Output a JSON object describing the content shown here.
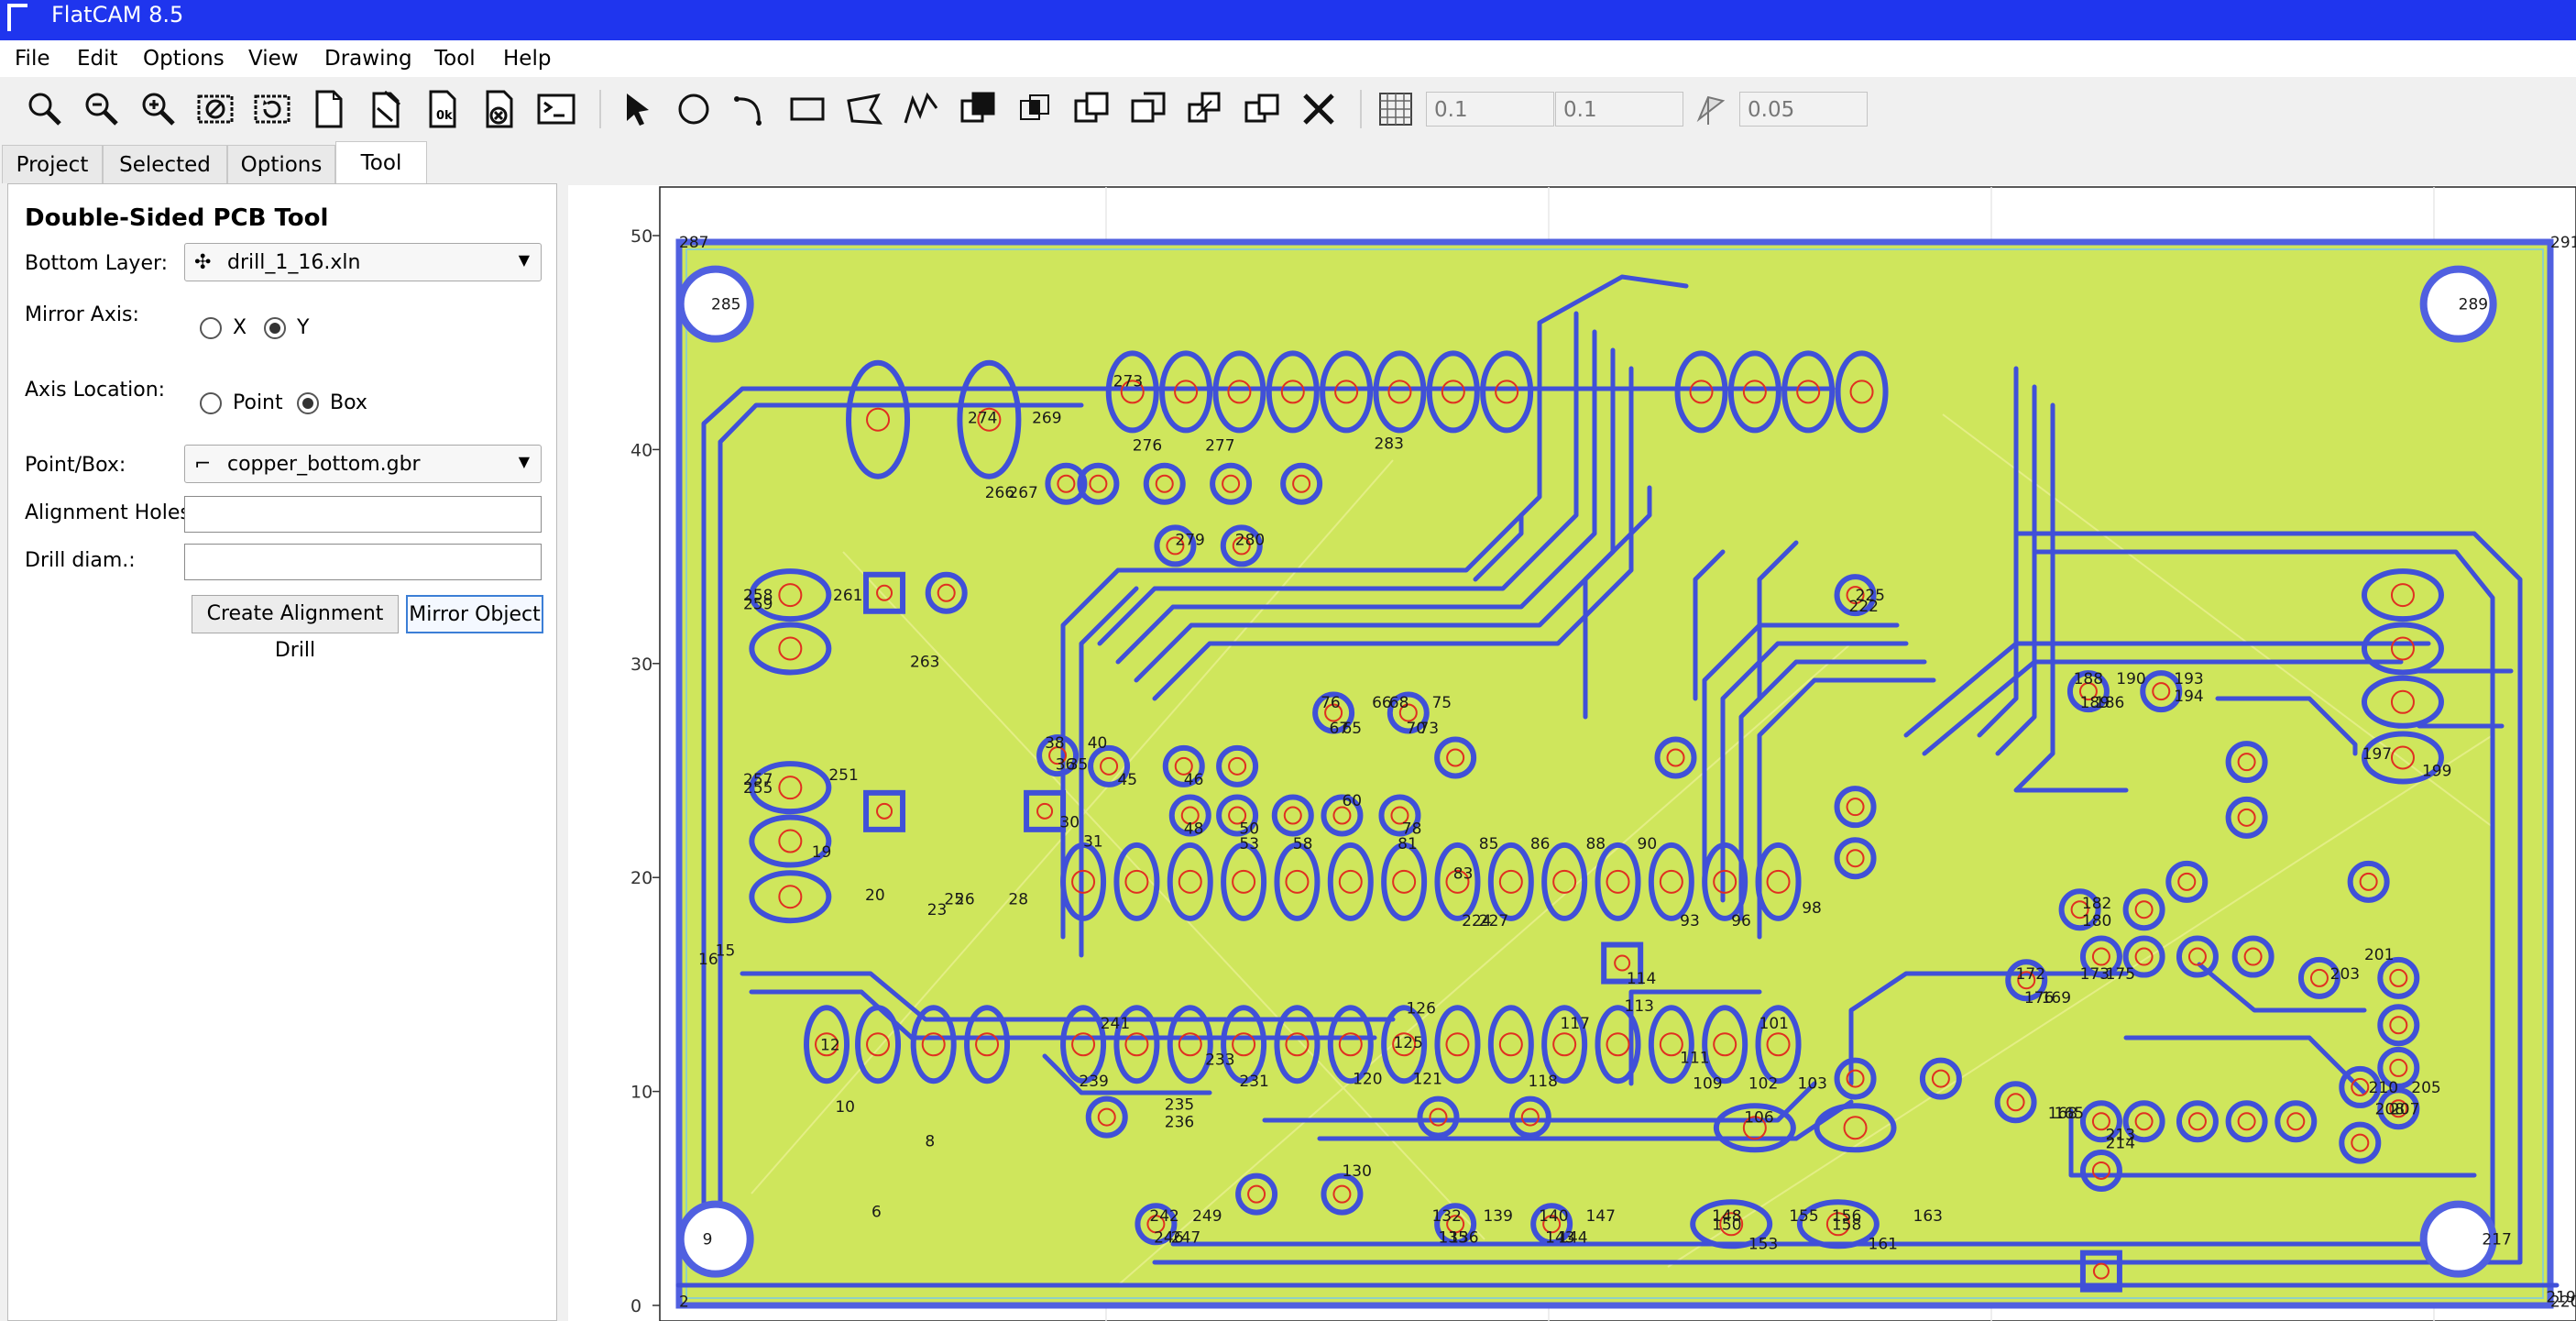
{
  "window": {
    "title": "FlatCAM 8.5"
  },
  "menu": [
    "File",
    "Edit",
    "Options",
    "View",
    "Drawing",
    "Tool",
    "Help"
  ],
  "toolbar": {
    "icons": [
      "zoom-fit-icon",
      "zoom-out-icon",
      "zoom-in-icon",
      "clear-plot-icon",
      "replot-icon",
      "new-project-icon",
      "new-geometry-icon",
      "open-ok-icon",
      "delete-object-icon",
      "shell-icon",
      "select-arrow-icon",
      "circle-icon",
      "arc-icon",
      "rectangle-icon",
      "polygon-icon",
      "path-icon",
      "union-icon",
      "intersection-icon",
      "subtract-icon",
      "cutpath-icon",
      "copy-icon",
      "move-icon",
      "delete-shape-icon",
      "grid-icon",
      "snap-corner-icon"
    ],
    "grid_x": "0.1",
    "grid_y": "0.1",
    "snap_distance": "0.05"
  },
  "tabs": [
    "Project",
    "Selected",
    "Options",
    "Tool"
  ],
  "active_tab": "Tool",
  "tool": {
    "title": "Double-Sided PCB Tool",
    "bottom_layer_label": "Bottom Layer:",
    "bottom_layer_value": "drill_1_16.xln",
    "mirror_axis_label": "Mirror Axis:",
    "mirror_options": [
      "X",
      "Y"
    ],
    "mirror_selected": "Y",
    "axis_location_label": "Axis Location:",
    "axis_options": [
      "Point",
      "Box"
    ],
    "axis_selected": "Box",
    "point_box_label": "Point/Box:",
    "point_box_value": "copper_bottom.gbr",
    "alignment_holes_label": "Alignment Holes:",
    "alignment_holes_value": "",
    "drill_diam_label": "Drill diam.:",
    "drill_diam_value": "",
    "create_button": "Create Alignment Drill",
    "mirror_button": "Mirror Object"
  },
  "plot": {
    "y_ticks": [
      "50",
      "40",
      "30",
      "20",
      "10",
      "0"
    ],
    "colors": {
      "copper_fill": "#cfe65c",
      "trace_outline": "#4050d8",
      "drill": "#e03020",
      "border": "#5060e0"
    },
    "pad_labels": [
      {
        "text": "287",
        "x": 0,
        "y": 49.7
      },
      {
        "text": "291",
        "x": 87.5,
        "y": 49.7
      },
      {
        "text": "285",
        "x": 1.5,
        "y": 46.8
      },
      {
        "text": "289",
        "x": 83.2,
        "y": 46.8
      },
      {
        "text": "273",
        "x": 20.3,
        "y": 43.2
      },
      {
        "text": "274",
        "x": 13.5,
        "y": 41.5
      },
      {
        "text": "269",
        "x": 16.5,
        "y": 41.5
      },
      {
        "text": "276",
        "x": 21.2,
        "y": 40.2
      },
      {
        "text": "277",
        "x": 24.6,
        "y": 40.2
      },
      {
        "text": "283",
        "x": 32.5,
        "y": 40.3
      },
      {
        "text": "266",
        "x": 14.3,
        "y": 38.0
      },
      {
        "text": "267",
        "x": 15.4,
        "y": 38.0
      },
      {
        "text": "279",
        "x": 23.2,
        "y": 35.8
      },
      {
        "text": "280",
        "x": 26.0,
        "y": 35.8
      },
      {
        "text": "258",
        "x": 3.0,
        "y": 33.2
      },
      {
        "text": "259",
        "x": 3.0,
        "y": 32.8
      },
      {
        "text": "261",
        "x": 7.2,
        "y": 33.2
      },
      {
        "text": "263",
        "x": 10.8,
        "y": 30.1
      },
      {
        "text": "225",
        "x": 55.0,
        "y": 33.2
      },
      {
        "text": "222",
        "x": 54.7,
        "y": 32.7
      },
      {
        "text": "76",
        "x": 30.0,
        "y": 28.2
      },
      {
        "text": "66",
        "x": 32.4,
        "y": 28.2
      },
      {
        "text": "68",
        "x": 33.2,
        "y": 28.2
      },
      {
        "text": "75",
        "x": 35.2,
        "y": 28.2
      },
      {
        "text": "67",
        "x": 30.4,
        "y": 27.0
      },
      {
        "text": "65",
        "x": 31.0,
        "y": 27.0
      },
      {
        "text": "70",
        "x": 34.0,
        "y": 27.0
      },
      {
        "text": "73",
        "x": 34.6,
        "y": 27.0
      },
      {
        "text": "188",
        "x": 65.2,
        "y": 29.3
      },
      {
        "text": "190",
        "x": 67.2,
        "y": 29.3
      },
      {
        "text": "193",
        "x": 69.9,
        "y": 29.3
      },
      {
        "text": "189",
        "x": 65.5,
        "y": 28.2
      },
      {
        "text": "186",
        "x": 66.2,
        "y": 28.2
      },
      {
        "text": "194",
        "x": 69.9,
        "y": 28.5
      },
      {
        "text": "38",
        "x": 17.1,
        "y": 26.3
      },
      {
        "text": "40",
        "x": 19.1,
        "y": 26.3
      },
      {
        "text": "36",
        "x": 17.6,
        "y": 25.3
      },
      {
        "text": "35",
        "x": 18.2,
        "y": 25.3
      },
      {
        "text": "197",
        "x": 78.7,
        "y": 25.8
      },
      {
        "text": "199",
        "x": 81.5,
        "y": 25.0
      },
      {
        "text": "257",
        "x": 3.0,
        "y": 24.6
      },
      {
        "text": "255",
        "x": 3.0,
        "y": 24.2
      },
      {
        "text": "251",
        "x": 7.0,
        "y": 24.8
      },
      {
        "text": "45",
        "x": 20.5,
        "y": 24.6
      },
      {
        "text": "46",
        "x": 23.6,
        "y": 24.6
      },
      {
        "text": "60",
        "x": 31.0,
        "y": 23.6
      },
      {
        "text": "30",
        "x": 17.8,
        "y": 22.6
      },
      {
        "text": "31",
        "x": 18.9,
        "y": 21.7
      },
      {
        "text": "48",
        "x": 23.6,
        "y": 22.3
      },
      {
        "text": "50",
        "x": 26.2,
        "y": 22.3
      },
      {
        "text": "78",
        "x": 33.8,
        "y": 22.3
      },
      {
        "text": "53",
        "x": 26.2,
        "y": 21.6
      },
      {
        "text": "58",
        "x": 28.7,
        "y": 21.6
      },
      {
        "text": "81",
        "x": 33.6,
        "y": 21.6
      },
      {
        "text": "85",
        "x": 37.4,
        "y": 21.6
      },
      {
        "text": "86",
        "x": 39.8,
        "y": 21.6
      },
      {
        "text": "88",
        "x": 42.4,
        "y": 21.6
      },
      {
        "text": "90",
        "x": 44.8,
        "y": 21.6
      },
      {
        "text": "19",
        "x": 6.2,
        "y": 21.2
      },
      {
        "text": "83",
        "x": 36.2,
        "y": 20.2
      },
      {
        "text": "20",
        "x": 8.7,
        "y": 19.2
      },
      {
        "text": "25",
        "x": 12.4,
        "y": 19.0
      },
      {
        "text": "26",
        "x": 12.9,
        "y": 19.0
      },
      {
        "text": "28",
        "x": 15.4,
        "y": 19.0
      },
      {
        "text": "23",
        "x": 11.6,
        "y": 18.5
      },
      {
        "text": "98",
        "x": 52.5,
        "y": 18.6
      },
      {
        "text": "182",
        "x": 65.6,
        "y": 18.8
      },
      {
        "text": "180",
        "x": 65.6,
        "y": 18.0
      },
      {
        "text": "224",
        "x": 36.6,
        "y": 18.0
      },
      {
        "text": "227",
        "x": 37.4,
        "y": 18.0
      },
      {
        "text": "93",
        "x": 46.8,
        "y": 18.0
      },
      {
        "text": "96",
        "x": 49.2,
        "y": 18.0
      },
      {
        "text": "16",
        "x": 0.9,
        "y": 16.2
      },
      {
        "text": "15",
        "x": 1.7,
        "y": 16.6
      },
      {
        "text": "114",
        "x": 44.3,
        "y": 15.3
      },
      {
        "text": "113",
        "x": 44.2,
        "y": 14.0
      },
      {
        "text": "172",
        "x": 62.5,
        "y": 15.5
      },
      {
        "text": "173",
        "x": 65.5,
        "y": 15.5
      },
      {
        "text": "175",
        "x": 66.7,
        "y": 15.5
      },
      {
        "text": "176",
        "x": 62.9,
        "y": 14.4
      },
      {
        "text": "169",
        "x": 63.7,
        "y": 14.4
      },
      {
        "text": "201",
        "x": 78.8,
        "y": 16.4
      },
      {
        "text": "203",
        "x": 77.2,
        "y": 15.5
      },
      {
        "text": "126",
        "x": 34.0,
        "y": 13.9
      },
      {
        "text": "117",
        "x": 41.2,
        "y": 13.2
      },
      {
        "text": "101",
        "x": 50.5,
        "y": 13.2
      },
      {
        "text": "12",
        "x": 6.6,
        "y": 12.2
      },
      {
        "text": "241",
        "x": 19.7,
        "y": 13.2
      },
      {
        "text": "125",
        "x": 33.4,
        "y": 12.3
      },
      {
        "text": "111",
        "x": 46.8,
        "y": 11.6
      },
      {
        "text": "233",
        "x": 24.6,
        "y": 11.5
      },
      {
        "text": "239",
        "x": 18.7,
        "y": 10.5
      },
      {
        "text": "231",
        "x": 26.2,
        "y": 10.5
      },
      {
        "text": "120",
        "x": 31.5,
        "y": 10.6
      },
      {
        "text": "121",
        "x": 34.3,
        "y": 10.6
      },
      {
        "text": "118",
        "x": 39.7,
        "y": 10.5
      },
      {
        "text": "109",
        "x": 47.4,
        "y": 10.4
      },
      {
        "text": "102",
        "x": 50.0,
        "y": 10.4
      },
      {
        "text": "103",
        "x": 52.3,
        "y": 10.4
      },
      {
        "text": "10",
        "x": 7.3,
        "y": 9.3
      },
      {
        "text": "210",
        "x": 79.0,
        "y": 10.2
      },
      {
        "text": "205",
        "x": 81.0,
        "y": 10.2
      },
      {
        "text": "208",
        "x": 79.3,
        "y": 9.2
      },
      {
        "text": "207",
        "x": 80.0,
        "y": 9.2
      },
      {
        "text": "235",
        "x": 22.7,
        "y": 9.4
      },
      {
        "text": "236",
        "x": 22.7,
        "y": 8.6
      },
      {
        "text": "106",
        "x": 49.8,
        "y": 8.8
      },
      {
        "text": "168",
        "x": 64.0,
        "y": 9.0
      },
      {
        "text": "165",
        "x": 64.3,
        "y": 9.0
      },
      {
        "text": "213",
        "x": 66.7,
        "y": 8.0
      },
      {
        "text": "214",
        "x": 66.7,
        "y": 7.6
      },
      {
        "text": "8",
        "x": 11.5,
        "y": 7.7
      },
      {
        "text": "130",
        "x": 31.0,
        "y": 6.3
      },
      {
        "text": "6",
        "x": 9.0,
        "y": 4.4
      },
      {
        "text": "242",
        "x": 22.0,
        "y": 4.2
      },
      {
        "text": "249",
        "x": 24.0,
        "y": 4.2
      },
      {
        "text": "132",
        "x": 35.2,
        "y": 4.2
      },
      {
        "text": "139",
        "x": 37.6,
        "y": 4.2
      },
      {
        "text": "140",
        "x": 40.2,
        "y": 4.2
      },
      {
        "text": "147",
        "x": 42.4,
        "y": 4.2
      },
      {
        "text": "148",
        "x": 48.3,
        "y": 4.2
      },
      {
        "text": "155",
        "x": 51.9,
        "y": 4.2
      },
      {
        "text": "156",
        "x": 53.9,
        "y": 4.2
      },
      {
        "text": "163",
        "x": 57.7,
        "y": 4.2
      },
      {
        "text": "150",
        "x": 48.3,
        "y": 3.8
      },
      {
        "text": "158",
        "x": 53.9,
        "y": 3.8
      },
      {
        "text": "246",
        "x": 22.2,
        "y": 3.2
      },
      {
        "text": "247",
        "x": 23.0,
        "y": 3.2
      },
      {
        "text": "135",
        "x": 35.5,
        "y": 3.2
      },
      {
        "text": "136",
        "x": 36.0,
        "y": 3.2
      },
      {
        "text": "143",
        "x": 40.5,
        "y": 3.2
      },
      {
        "text": "144",
        "x": 41.1,
        "y": 3.2
      },
      {
        "text": "153",
        "x": 50.0,
        "y": 2.9
      },
      {
        "text": "161",
        "x": 55.6,
        "y": 2.9
      },
      {
        "text": "9",
        "x": 1.1,
        "y": 3.1
      },
      {
        "text": "217",
        "x": 84.3,
        "y": 3.1
      },
      {
        "text": "2",
        "x": 0.0,
        "y": 0.2
      },
      {
        "text": "220",
        "x": 87.5,
        "y": 0.2
      },
      {
        "text": "219",
        "x": 87.3,
        "y": 0.4
      }
    ]
  }
}
